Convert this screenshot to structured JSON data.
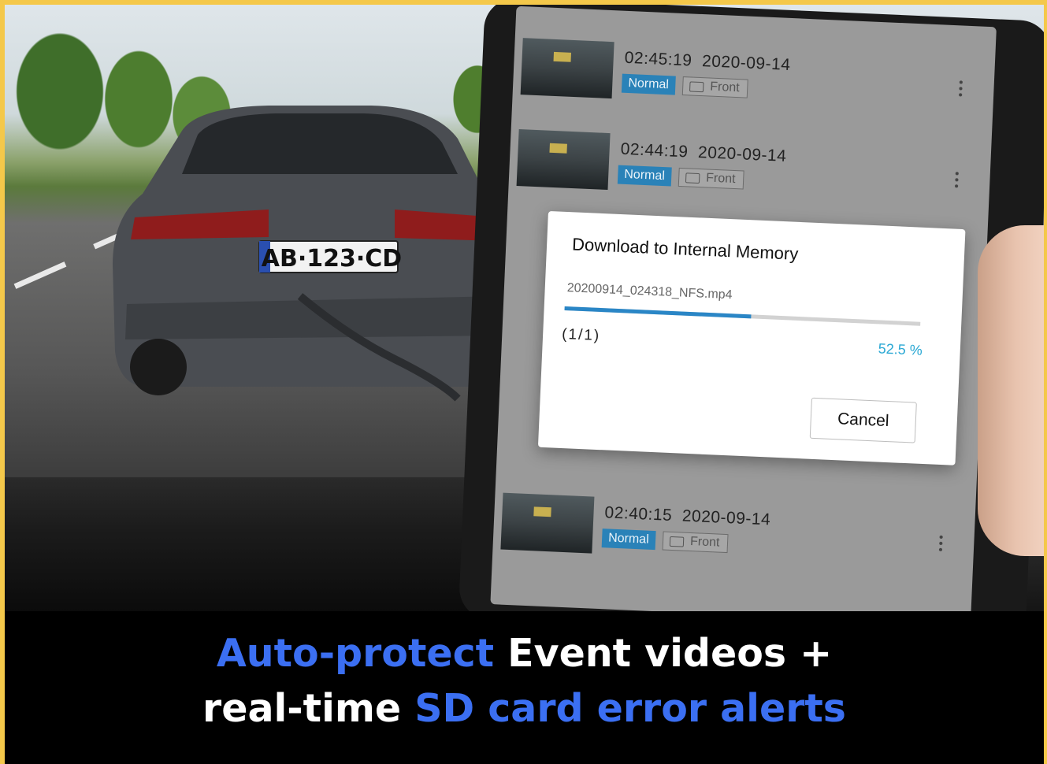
{
  "plate": {
    "text": "AB·123·CD"
  },
  "events": [
    {
      "time": "02:45:19",
      "date": "2020-09-14",
      "type": "Normal",
      "camera": "Front"
    },
    {
      "time": "02:44:19",
      "date": "2020-09-14",
      "type": "Normal",
      "camera": "Front"
    },
    {
      "time": "02:40:15",
      "date": "2020-09-14",
      "type": "Normal",
      "camera": "Front"
    }
  ],
  "dialog": {
    "title": "Download to Internal Memory",
    "filename": "20200914_024318_NFS.mp4",
    "count": "(1/1)",
    "percent_text": "52.5 %",
    "progress": 0.525,
    "cancel_label": "Cancel"
  },
  "caption": {
    "line1_accent": "Auto-protect",
    "line1_rest": " Event videos +",
    "line2_plain": "real-time ",
    "line2_accent": "SD card error alerts"
  },
  "colors": {
    "frame": "#f4c84a",
    "accent": "#3b6ff2",
    "badge": "#2a82b8",
    "progress": "#2a86c6",
    "percent": "#2aa8d4"
  }
}
